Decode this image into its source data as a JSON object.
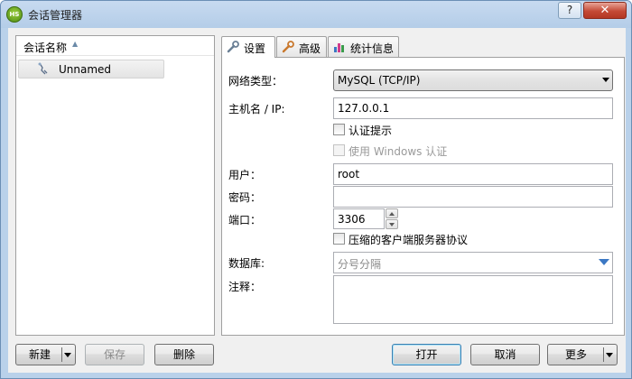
{
  "window": {
    "title": "会话管理器",
    "app_icon_text": "HS",
    "help_label": "?",
    "close_label": "✕"
  },
  "session_list": {
    "column_header": "会话名称",
    "sessions": [
      {
        "name": "Unnamed"
      }
    ]
  },
  "tabs": [
    {
      "label": "设置",
      "icon": "wrench-icon",
      "active": true
    },
    {
      "label": "高级",
      "icon": "wrench-icon",
      "active": false
    },
    {
      "label": "统计信息",
      "icon": "bar-chart-icon",
      "active": false
    }
  ],
  "settings": {
    "network_type_label": "网络类型：",
    "network_type_value": "MySQL (TCP/IP)",
    "host_label": "主机名 / IP:",
    "host_value": "127.0.0.1",
    "auth_prompt_label": "认证提示",
    "windows_auth_label": "使用 Windows 认证",
    "user_label": "用户：",
    "user_value": "root",
    "password_label": "密码：",
    "password_value": "",
    "port_label": "端口：",
    "port_value": "3306",
    "compress_label": "压缩的客户端服务器协议",
    "database_label": "数据库:",
    "database_placeholder": "分号分隔",
    "notes_label": "注释：",
    "notes_value": ""
  },
  "buttons": {
    "new": "新建",
    "save": "保存",
    "delete": "删除",
    "open": "打开",
    "cancel": "取消",
    "more": "更多"
  },
  "colors": {
    "frame": "#b9d1ea",
    "close_button": "#c44a36",
    "accent_blue": "#3b78c4"
  }
}
